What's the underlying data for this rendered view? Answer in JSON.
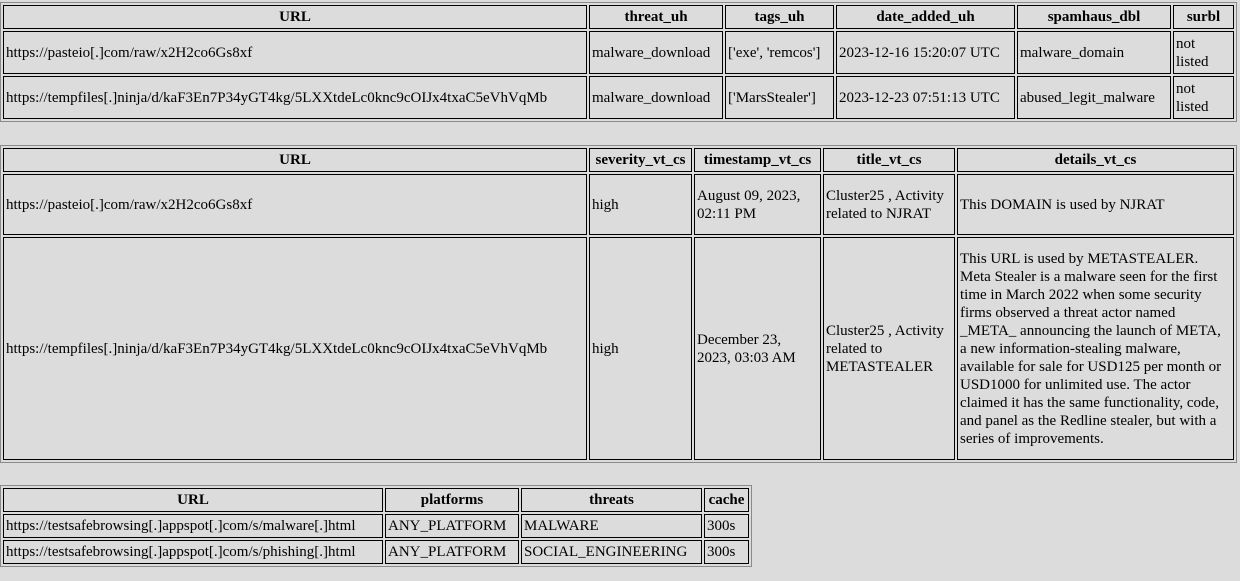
{
  "table_uh": {
    "headers": [
      "URL",
      "threat_uh",
      "tags_uh",
      "date_added_uh",
      "spamhaus_dbl",
      "surbl"
    ],
    "rows": [
      [
        "https://pasteio[.]com/raw/x2H2co6Gs8xf",
        "malware_download",
        "['exe', 'remcos']",
        "2023-12-16 15:20:07 UTC",
        "malware_domain",
        "not listed"
      ],
      [
        "https://tempfiles[.]ninja/d/kaF3En7P34yGT4kg/5LXXtdeLc0knc9cOIJx4txaC5eVhVqMb",
        "malware_download",
        "['MarsStealer']",
        "2023-12-23 07:51:13 UTC",
        "abused_legit_malware",
        "not listed"
      ]
    ]
  },
  "table_vt": {
    "headers": [
      "URL",
      "severity_vt_cs",
      "timestamp_vt_cs",
      "title_vt_cs",
      "details_vt_cs"
    ],
    "rows": [
      [
        "https://pasteio[.]com/raw/x2H2co6Gs8xf",
        "high",
        "August 09, 2023, 02:11 PM",
        "Cluster25 , Activity related to NJRAT",
        "This DOMAIN is used by NJRAT"
      ],
      [
        "https://tempfiles[.]ninja/d/kaF3En7P34yGT4kg/5LXXtdeLc0knc9cOIJx4txaC5eVhVqMb",
        "high",
        "December 23, 2023, 03:03 AM",
        "Cluster25 , Activity related to METASTEALER",
        "This URL is used by METASTEALER. Meta Stealer is a malware seen for the first time in March 2022 when some security firms observed a threat actor named _META_ announcing the launch of META, a new information-stealing malware, available for sale for USD125 per month or USD1000 for unlimited use. The actor claimed it has the same functionality, code, and panel as the Redline stealer, but with a series of improvements."
      ]
    ]
  },
  "table_gsb": {
    "headers": [
      "URL",
      "platforms",
      "threats",
      "cache"
    ],
    "rows": [
      [
        "https://testsafebrowsing[.]appspot[.]com/s/malware[.]html",
        "ANY_PLATFORM",
        "MALWARE",
        "300s"
      ],
      [
        "https://testsafebrowsing[.]appspot[.]com/s/phishing[.]html",
        "ANY_PLATFORM",
        "SOCIAL_ENGINEERING",
        "300s"
      ]
    ]
  }
}
